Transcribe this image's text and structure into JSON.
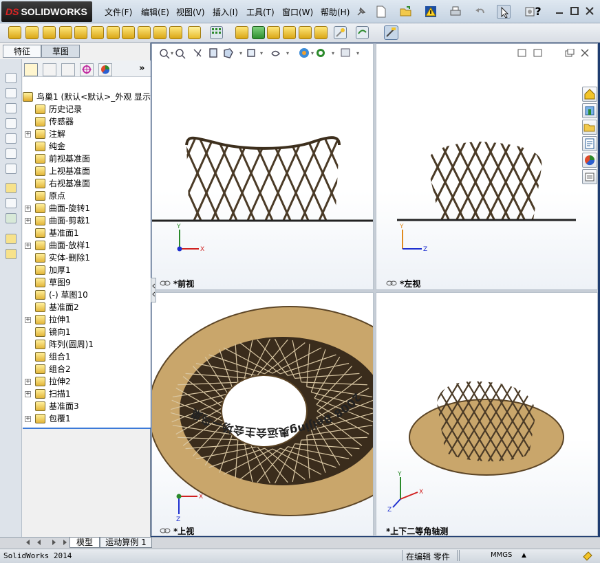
{
  "app": {
    "logo_text": "SOLIDWORKS",
    "logo_prefix": "DS"
  },
  "menu": [
    "文件(F)",
    "编辑(E)",
    "视图(V)",
    "插入(I)",
    "工具(T)",
    "窗口(W)",
    "帮助(H)"
  ],
  "pane_tabs": [
    "特征",
    "草图"
  ],
  "tree": {
    "root": "鸟巢1  (默认<默认>_外观 显示",
    "items": [
      {
        "label": "历史记录",
        "expand": false
      },
      {
        "label": "传感器",
        "expand": false
      },
      {
        "label": "注解",
        "expand": true
      },
      {
        "label": "纯金",
        "expand": false
      },
      {
        "label": "前视基准面",
        "expand": false
      },
      {
        "label": "上视基准面",
        "expand": false
      },
      {
        "label": "右视基准面",
        "expand": false
      },
      {
        "label": "原点",
        "expand": false
      },
      {
        "label": "曲面-旋转1",
        "expand": true
      },
      {
        "label": "曲面-剪裁1",
        "expand": true
      },
      {
        "label": "基准面1",
        "expand": false
      },
      {
        "label": "曲面-放样1",
        "expand": true
      },
      {
        "label": "实体-删除1",
        "expand": false
      },
      {
        "label": "加厚1",
        "expand": false
      },
      {
        "label": "草图9",
        "expand": false
      },
      {
        "label": "(-) 草图10",
        "expand": false
      },
      {
        "label": "基准面2",
        "expand": false
      },
      {
        "label": "拉伸1",
        "expand": true
      },
      {
        "label": "镜向1",
        "expand": false
      },
      {
        "label": "阵列(圆周)1",
        "expand": false
      },
      {
        "label": "组合1",
        "expand": false
      },
      {
        "label": "组合2",
        "expand": false
      },
      {
        "label": "拉伸2",
        "expand": true
      },
      {
        "label": "扫描1",
        "expand": true
      },
      {
        "label": "基准面3",
        "expand": false
      },
      {
        "label": "包覆1",
        "expand": true
      }
    ]
  },
  "viewports": {
    "front": "*前视",
    "left": "*左视",
    "top": "*上视",
    "iso": "*上下二等角轴测"
  },
  "ring_text": "2008 Beijing奥运会主会场—鸟巢",
  "axis_labels": {
    "x": "X",
    "y": "Y",
    "z": "Z"
  },
  "bottom_tabs": [
    "模型",
    "运动算例 1"
  ],
  "status": {
    "app": "SolidWorks 2014",
    "mode": "在编辑 零件",
    "units": "MMGS"
  },
  "colors": {
    "accent": "#f3c429",
    "model": "#4a3a26",
    "base": "#c9a66b"
  }
}
